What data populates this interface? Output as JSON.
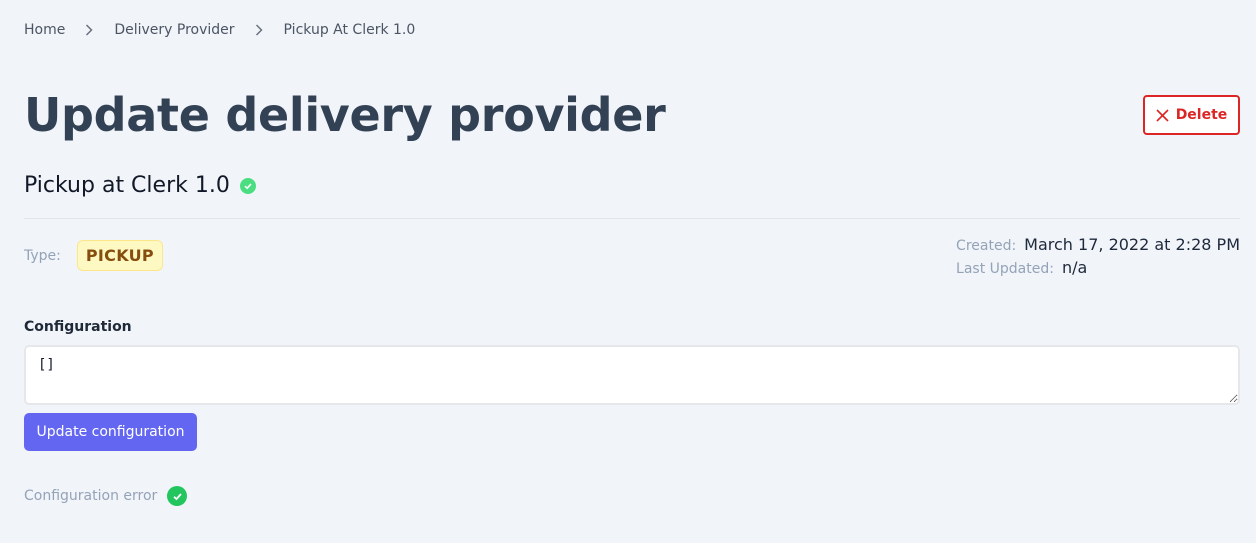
{
  "breadcrumb": {
    "items": [
      "Home",
      "Delivery Provider",
      "Pickup At Clerk 1.0"
    ]
  },
  "header": {
    "title": "Update delivery provider",
    "delete_label": "Delete"
  },
  "provider": {
    "name": "Pickup at Clerk 1.0",
    "status_icon": "check-circle-icon",
    "status_color": "#4ade80"
  },
  "details": {
    "type_label": "Type:",
    "type_value": "PICKUP",
    "created_label": "Created:",
    "created_value": "March 17, 2022 at 2:28 PM",
    "updated_label": "Last Updated:",
    "updated_value": "n/a"
  },
  "configuration": {
    "label": "Configuration",
    "value": "[]",
    "update_label": "Update configuration",
    "error_label": "Configuration error",
    "error_icon": "check-circle-icon"
  },
  "colors": {
    "primary": "#6366f1",
    "danger": "#dc2626",
    "success": "#22c55e",
    "badge_bg": "#fef9c3",
    "badge_text": "#854d0e"
  }
}
